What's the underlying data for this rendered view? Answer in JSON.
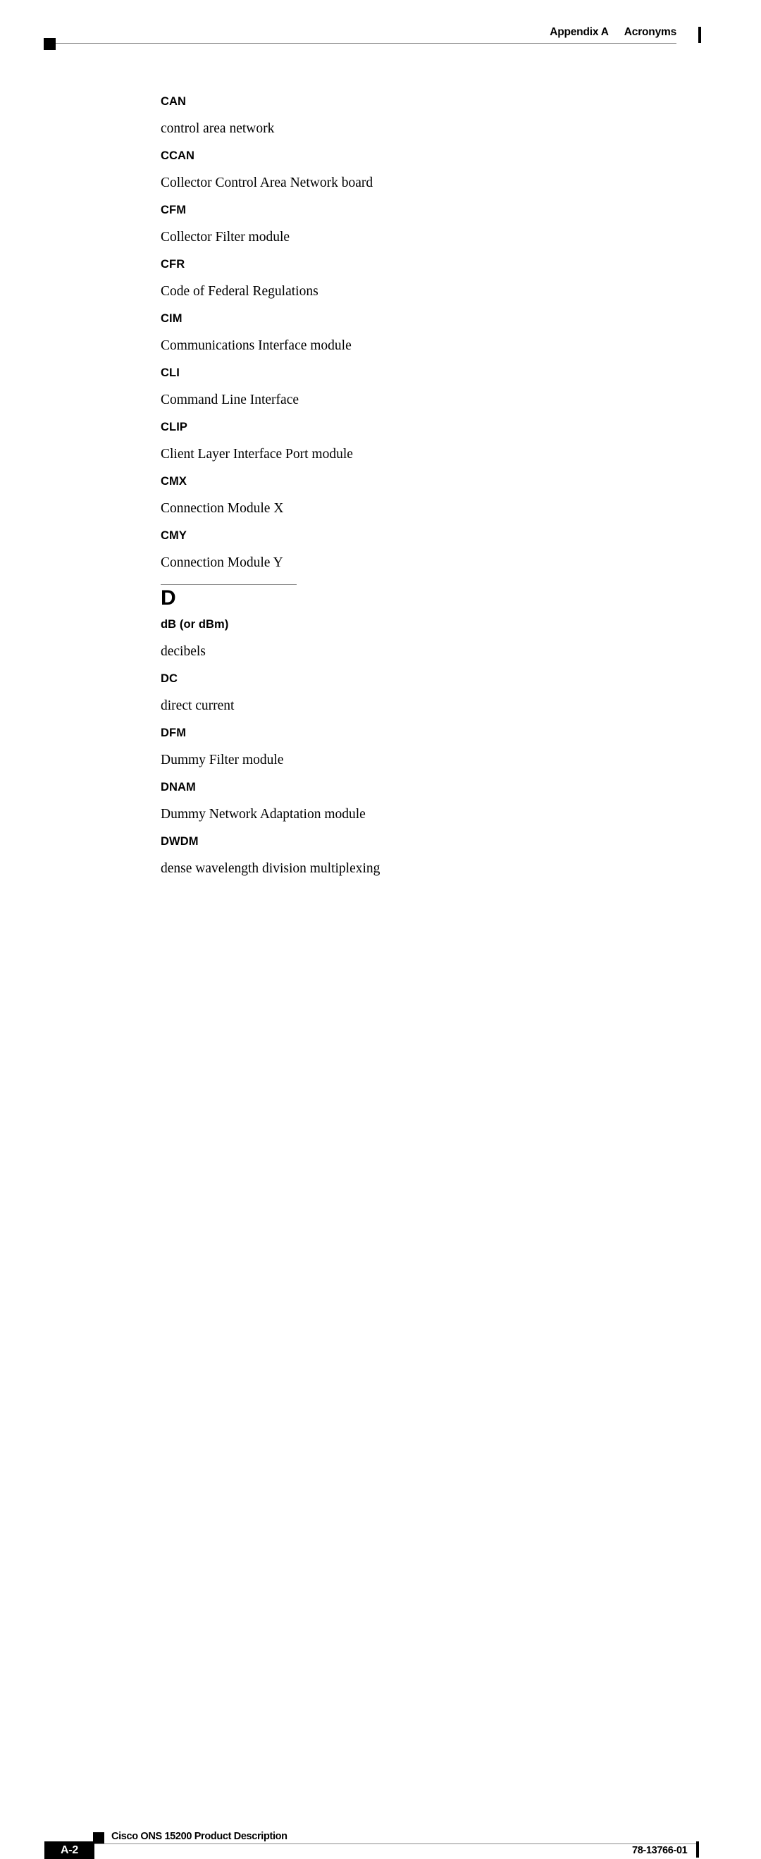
{
  "page": {
    "background_color": "#ffffff",
    "rule_color": "#8d8d8d",
    "ink_color": "#000000"
  },
  "header": {
    "appendix_label": "Appendix A",
    "section_label": "Acronyms",
    "marker_icon": "black-square-marker",
    "edge_bar_icon": "change-bar-marker"
  },
  "glossary": {
    "entries": [
      {
        "term": "CAN",
        "definition": "control area network"
      },
      {
        "term": "CCAN",
        "definition": "Collector Control Area Network board"
      },
      {
        "term": "CFM",
        "definition": "Collector Filter module"
      },
      {
        "term": "CFR",
        "definition": "Code of Federal Regulations"
      },
      {
        "term": "CIM",
        "definition": "Communications Interface module"
      },
      {
        "term": "CLI",
        "definition": "Command Line Interface"
      },
      {
        "term": "CLIP",
        "definition": "Client Layer Interface Port module"
      },
      {
        "term": "CMX",
        "definition": "Connection Module X"
      },
      {
        "term": "CMY",
        "definition": "Connection Module Y"
      }
    ],
    "section": {
      "letter": "D",
      "entries": [
        {
          "term": "dB (or dBm)",
          "definition": "decibels"
        },
        {
          "term": "DC",
          "definition": "direct current"
        },
        {
          "term": "DFM",
          "definition": "Dummy Filter module"
        },
        {
          "term": "DNAM",
          "definition": "Dummy Network Adaptation module"
        },
        {
          "term": "DWDM",
          "definition": "dense wavelength division multiplexing"
        }
      ]
    }
  },
  "footer": {
    "page_number": "A-2",
    "document_title": "Cisco ONS 15200 Product Description",
    "document_number": "78-13766-01",
    "marker_icon": "black-square-marker",
    "edge_bar_icon": "change-bar-marker"
  }
}
